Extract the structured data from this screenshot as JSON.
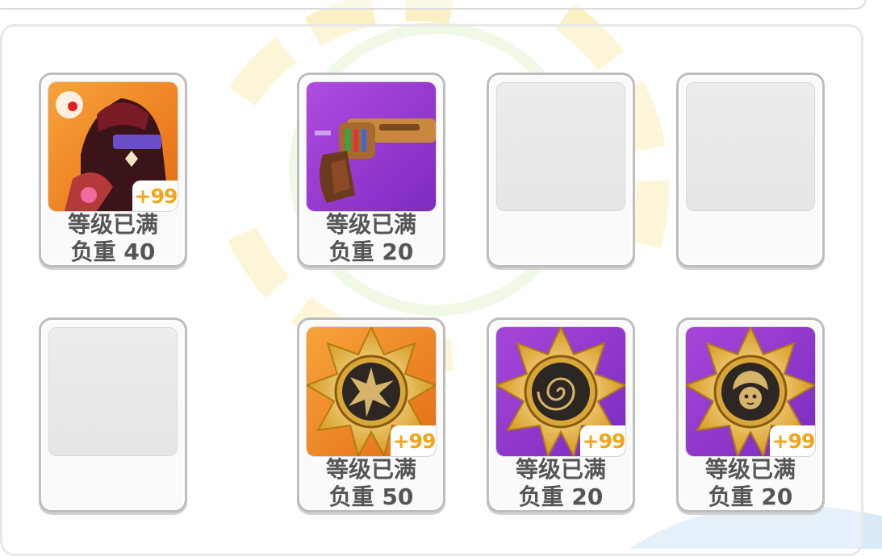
{
  "colors": {
    "badge_text": "#f2a51b",
    "label_text": "#555555",
    "slot_border": "#bdbdbd",
    "purple_bg": "#9b3bd6",
    "orange_bg": "#ee8a1f"
  },
  "slots": [
    {
      "empty": false,
      "icon": "character-card-icon",
      "badge": "+99",
      "status": "等级已满",
      "weight": "负重 40"
    },
    {
      "empty": false,
      "icon": "revolver-weapon-icon",
      "badge": "",
      "status": "等级已满",
      "weight": "负重 20"
    },
    {
      "empty": true
    },
    {
      "empty": true
    },
    {
      "empty": true
    },
    {
      "empty": false,
      "icon": "gold-medal-sun-icon",
      "badge": "+99",
      "status": "等级已满",
      "weight": "负重 50"
    },
    {
      "empty": false,
      "icon": "gold-medal-swirl-icon",
      "badge": "+99",
      "status": "等级已满",
      "weight": "负重 20"
    },
    {
      "empty": false,
      "icon": "gold-medal-face-icon",
      "badge": "+99",
      "status": "等级已满",
      "weight": "负重 20"
    }
  ]
}
